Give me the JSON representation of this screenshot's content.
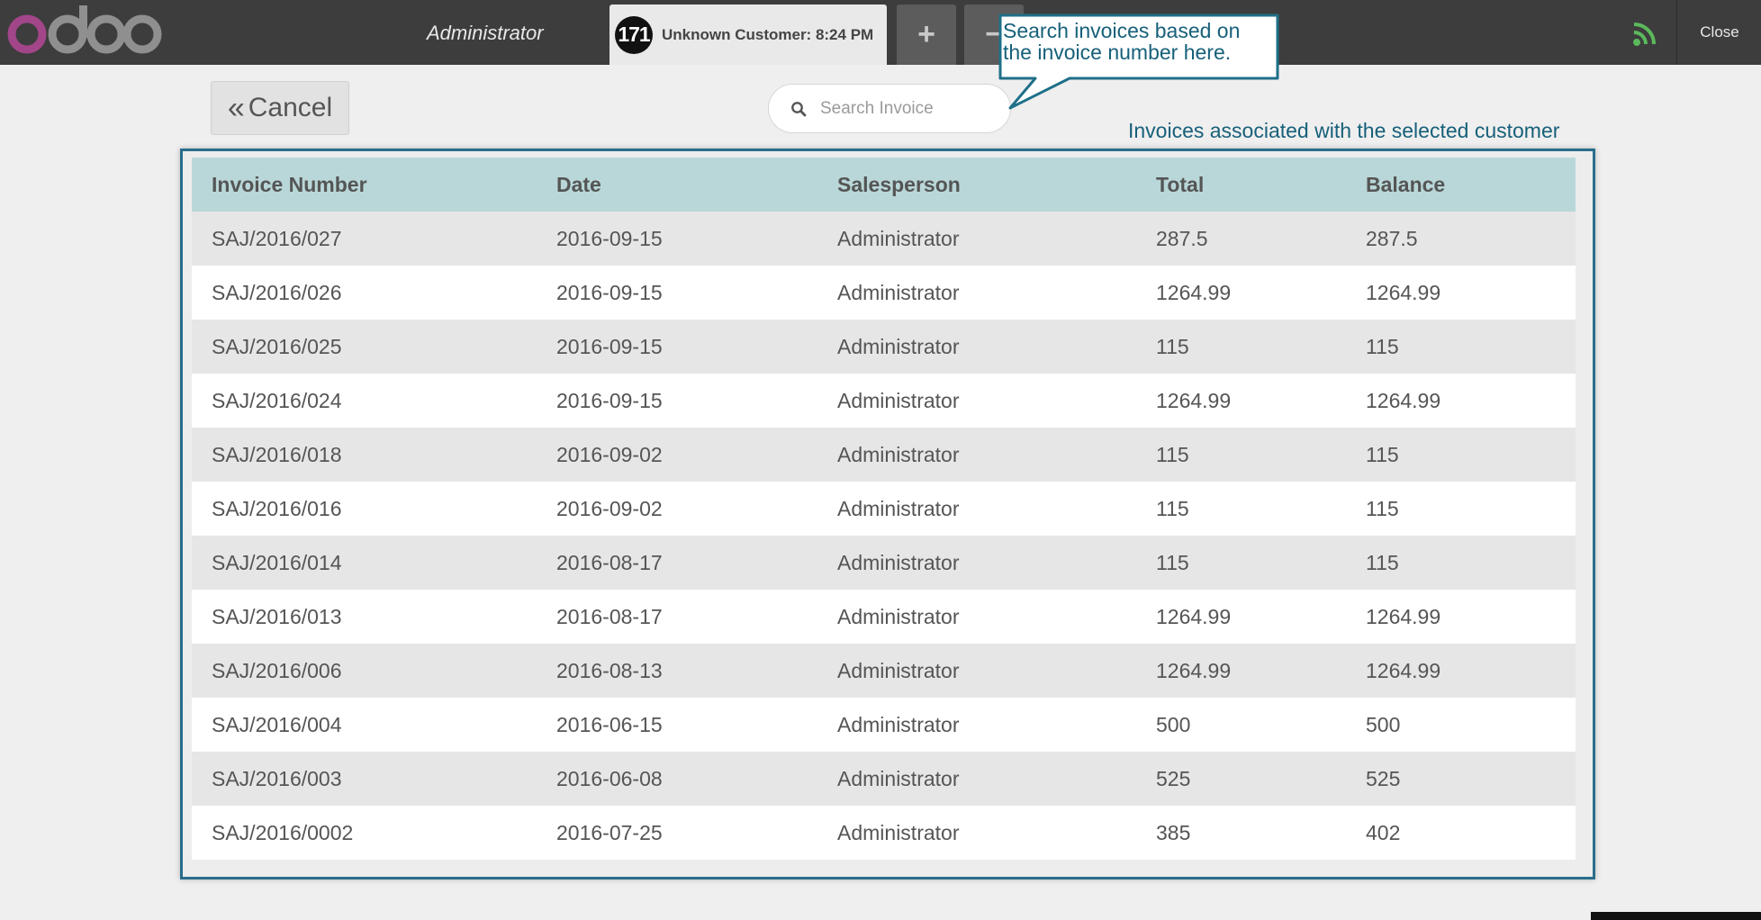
{
  "colors": {
    "topbar": "#3d3d3d",
    "logo_o": "#a24689",
    "logo_doo": "#8f8f8f",
    "accent": "#2a6d8c",
    "header_row": "#b9d7d8",
    "wifi": "#5cb85c"
  },
  "topbar": {
    "logo_text": "odoo",
    "user": "Administrator",
    "order_badge": "171",
    "order_label": "Unknown Customer: 8:24 PM",
    "add_icon": "plus-icon",
    "remove_icon": "minus-icon",
    "connection_icon": "wifi-icon",
    "close_label": "Close"
  },
  "cancel": {
    "label": "Cancel",
    "icon": "double-chevron-left-icon"
  },
  "search": {
    "placeholder": "Search Invoice",
    "icon": "search-icon"
  },
  "annotations": {
    "search_callout": "Search invoices based on the invoice number here.",
    "table_caption": "Invoices associated with the selected customer"
  },
  "table": {
    "columns": [
      "Invoice Number",
      "Date",
      "Salesperson",
      "Total",
      "Balance"
    ],
    "rows": [
      [
        "SAJ/2016/027",
        "2016-09-15",
        "Administrator",
        "287.5",
        "287.5"
      ],
      [
        "SAJ/2016/026",
        "2016-09-15",
        "Administrator",
        "1264.99",
        "1264.99"
      ],
      [
        "SAJ/2016/025",
        "2016-09-15",
        "Administrator",
        "115",
        "115"
      ],
      [
        "SAJ/2016/024",
        "2016-09-15",
        "Administrator",
        "1264.99",
        "1264.99"
      ],
      [
        "SAJ/2016/018",
        "2016-09-02",
        "Administrator",
        "115",
        "115"
      ],
      [
        "SAJ/2016/016",
        "2016-09-02",
        "Administrator",
        "115",
        "115"
      ],
      [
        "SAJ/2016/014",
        "2016-08-17",
        "Administrator",
        "115",
        "115"
      ],
      [
        "SAJ/2016/013",
        "2016-08-17",
        "Administrator",
        "1264.99",
        "1264.99"
      ],
      [
        "SAJ/2016/006",
        "2016-08-13",
        "Administrator",
        "1264.99",
        "1264.99"
      ],
      [
        "SAJ/2016/004",
        "2016-06-15",
        "Administrator",
        "500",
        "500"
      ],
      [
        "SAJ/2016/003",
        "2016-06-08",
        "Administrator",
        "525",
        "525"
      ],
      [
        "SAJ/2016/0002",
        "2016-07-25",
        "Administrator",
        "385",
        "402"
      ]
    ]
  }
}
